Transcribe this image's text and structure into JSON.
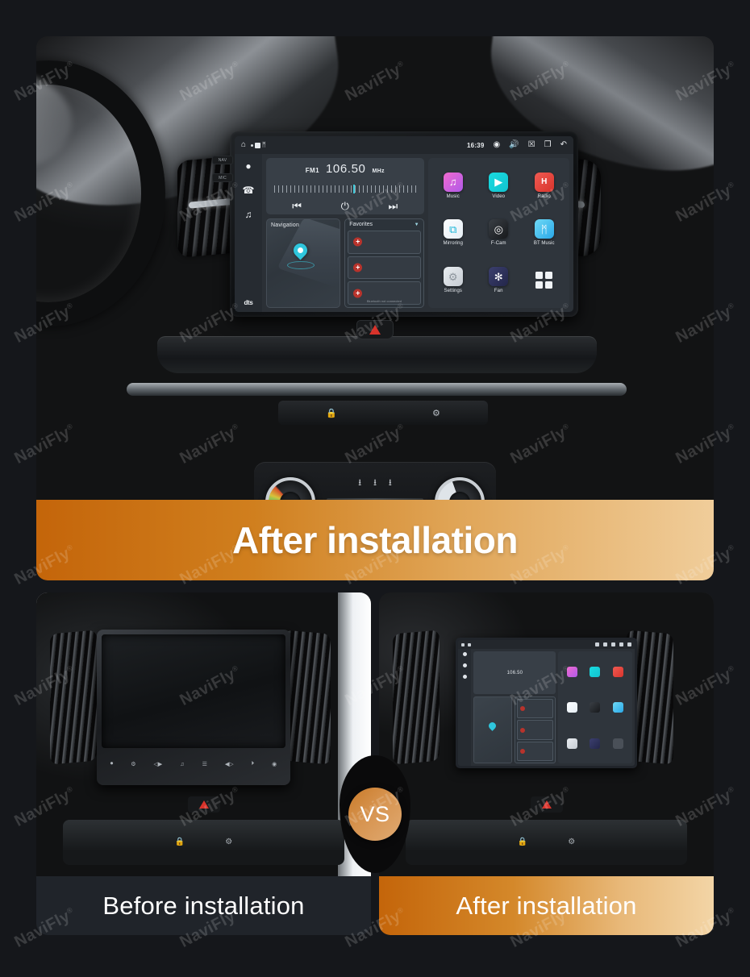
{
  "background_color": "#15171b",
  "brand": {
    "watermark_text": "NaviFly",
    "watermark_mark": "®"
  },
  "hero": {
    "caption": "After installation",
    "caption_gradient_from": "#c4650a",
    "caption_gradient_to": "#f0cd9a"
  },
  "head_unit": {
    "statusbar": {
      "home_icon": "home-icon",
      "time": "16:39",
      "bluetooth_icon": "bluetooth-icon",
      "camera_icon": "camera-icon",
      "volume_icon": "volume-icon",
      "close_icon": "close-icon",
      "recents_icon": "recents-icon",
      "back_icon": "back-icon"
    },
    "rail": {
      "items": [
        {
          "icon": "location-pin-icon",
          "glyph": "●"
        },
        {
          "icon": "phone-icon",
          "glyph": "✆"
        },
        {
          "icon": "music-note-icon",
          "glyph": "♫"
        }
      ],
      "brand": "dts"
    },
    "radio": {
      "band": "FM1",
      "frequency": "106.50",
      "unit": "MHz",
      "prev_label": "⏮",
      "power_label": "⏻",
      "next_label": "⏭"
    },
    "navigation": {
      "title": "Navigation"
    },
    "favorites": {
      "title": "Favorites",
      "chevron": "▼",
      "add_label": "+",
      "footer": "Bluetooth not connected",
      "slots": 3
    },
    "apps": [
      {
        "label": "Music",
        "icon": "music-app-icon",
        "glyph": "♫",
        "color": "#f06ad0"
      },
      {
        "label": "Video",
        "icon": "video-app-icon",
        "glyph": "▶",
        "color": "#19dbe0"
      },
      {
        "label": "Radio",
        "icon": "radio-app-icon",
        "glyph": "H",
        "color": "#f05a52"
      },
      {
        "label": "Mirroring",
        "icon": "mirroring-app-icon",
        "glyph": "⧉",
        "color": "#19b6d8"
      },
      {
        "label": "F-Cam",
        "icon": "front-camera-app-icon",
        "glyph": "◎",
        "color": "#2a2d31"
      },
      {
        "label": "BT Music",
        "icon": "bluetooth-music-app-icon",
        "glyph": "ᛗ",
        "color": "#2aa8e8"
      },
      {
        "label": "Settings",
        "icon": "settings-app-icon",
        "glyph": "⚙",
        "color": "#c6ccd3"
      },
      {
        "label": "Fan",
        "icon": "fan-app-icon",
        "glyph": "✻",
        "color": "#23264a"
      },
      {
        "label": "",
        "icon": "app-drawer-icon",
        "glyph": "",
        "color": "#f0f3f6"
      }
    ]
  },
  "compare": {
    "vs_badge": "VS",
    "before": {
      "caption": "Before installation",
      "caption_background": "#20242a"
    },
    "after": {
      "caption": "After installation",
      "caption_gradient_from": "#c4650a",
      "caption_gradient_to": "#f3d5a6"
    }
  }
}
